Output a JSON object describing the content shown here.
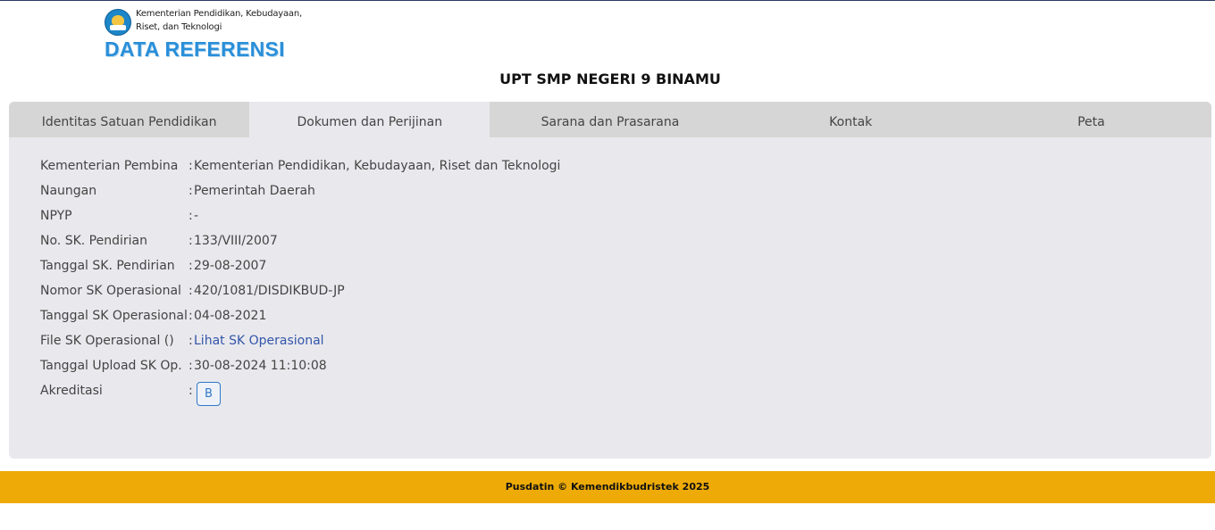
{
  "header": {
    "ministry_line1": "Kementerian Pendidikan, Kebudayaan,",
    "ministry_line2": "Riset, dan Teknologi",
    "brand_title": "DATA REFERENSI",
    "logo_icon": "tut-wuri-handayani-emblem-icon"
  },
  "school_name": "UPT SMP NEGERI 9 BINAMU",
  "tabs": [
    {
      "label": "Identitas Satuan Pendidikan",
      "active": false
    },
    {
      "label": "Dokumen dan Perijinan",
      "active": true
    },
    {
      "label": "Sarana dan Prasarana",
      "active": false
    },
    {
      "label": "Kontak",
      "active": false
    },
    {
      "label": "Peta",
      "active": false
    }
  ],
  "details": [
    {
      "label": "Kementerian Pembina",
      "value": "Kementerian Pendidikan, Kebudayaan, Riset dan Teknologi"
    },
    {
      "label": "Naungan",
      "value": "Pemerintah Daerah"
    },
    {
      "label": "NPYP",
      "value": "-"
    },
    {
      "label": "No. SK. Pendirian",
      "value": "133/VIII/2007"
    },
    {
      "label": "Tanggal SK. Pendirian",
      "value": "29-08-2007"
    },
    {
      "label": "Nomor SK Operasional",
      "value": "420/1081/DISDIKBUD-JP"
    },
    {
      "label": "Tanggal SK Operasional",
      "value": "04-08-2021"
    },
    {
      "label": "File SK Operasional ()",
      "value": "Lihat SK Operasional"
    },
    {
      "label": "Tanggal Upload SK Op.",
      "value": "30-08-2024 11:10:08"
    },
    {
      "label": "Akreditasi",
      "value": "B"
    }
  ],
  "colon": ":",
  "footer": "Pusdatin © Kemendikbudristek 2025",
  "colors": {
    "brand": "#2a8fd8",
    "footer": "#eeab07",
    "link": "#3355aa",
    "panel": "#e9e9ed"
  }
}
